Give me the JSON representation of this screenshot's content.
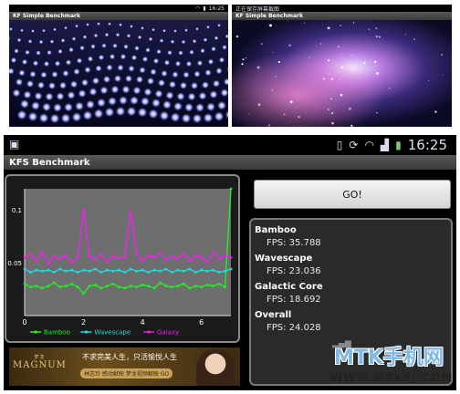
{
  "top_left": {
    "status_time": "16:25",
    "app_title": "KF Simple Benchmark"
  },
  "top_right": {
    "status_text": "正在保存屏幕截图",
    "app_title": "KF Simple Benchmark"
  },
  "main": {
    "status_time": "16:25",
    "app_title": "KFS Benchmark",
    "go_label": "GO!",
    "results": [
      {
        "name": "Bamboo",
        "fps": "FPS: 35.788"
      },
      {
        "name": "Wavescape",
        "fps": "FPS: 23.036"
      },
      {
        "name": "Galactic Core",
        "fps": "FPS: 18.692"
      },
      {
        "name": "Overall",
        "fps": "FPS: 24.028"
      }
    ],
    "ad": {
      "logo": "MAGNUM",
      "logo_sub": "梦龙",
      "line1": "不求完美人生，只活愉悦人生",
      "line2": "林志玲 感动献映 梦龙视频献映 GO"
    }
  },
  "watermark": {
    "title": "MTK手机网",
    "url": "WWW.MTKSJ.COM"
  },
  "colors": {
    "bamboo": "#22ee22",
    "wavescape": "#22dddd",
    "galaxy": "#ee22ee",
    "results_bg": "#2a2a2a"
  },
  "chart_data": {
    "type": "line",
    "xlim": [
      0,
      7
    ],
    "ylim": [
      0,
      0.12
    ],
    "x_ticks": [
      "0",
      "2",
      "4",
      "6"
    ],
    "y_ticks": [
      "0.1",
      "0.05"
    ],
    "series": [
      {
        "name": "Bamboo",
        "x": [
          0.0,
          0.2,
          0.4,
          0.6,
          0.8,
          1.0,
          1.2,
          1.4,
          1.6,
          1.8,
          2.0,
          2.2,
          2.4,
          2.6,
          2.8,
          3.0,
          3.2,
          3.4,
          3.6,
          3.8,
          4.0,
          4.2,
          4.4,
          4.6,
          4.8,
          5.0,
          5.2,
          5.4,
          5.6,
          5.8,
          6.0,
          6.2,
          6.4,
          6.6,
          6.8,
          7.0
        ],
        "values": [
          0.03,
          0.027,
          0.028,
          0.026,
          0.028,
          0.031,
          0.027,
          0.028,
          0.03,
          0.027,
          0.021,
          0.028,
          0.029,
          0.026,
          0.028,
          0.03,
          0.027,
          0.026,
          0.028,
          0.027,
          0.029,
          0.028,
          0.026,
          0.031,
          0.028,
          0.027,
          0.028,
          0.03,
          0.026,
          0.028,
          0.027,
          0.029,
          0.028,
          0.03,
          0.027,
          0.12
        ]
      },
      {
        "name": "Wavescape",
        "x": [
          0.0,
          0.2,
          0.4,
          0.6,
          0.8,
          1.0,
          1.2,
          1.4,
          1.6,
          1.8,
          2.0,
          2.2,
          2.4,
          2.6,
          2.8,
          3.0,
          3.2,
          3.4,
          3.6,
          3.8,
          4.0,
          4.2,
          4.4,
          4.6,
          4.8,
          5.0,
          5.2,
          5.4,
          5.6,
          5.8,
          6.0,
          6.2,
          6.4,
          6.6,
          6.8,
          7.0
        ],
        "values": [
          0.044,
          0.041,
          0.043,
          0.042,
          0.043,
          0.041,
          0.044,
          0.042,
          0.043,
          0.041,
          0.043,
          0.042,
          0.044,
          0.041,
          0.043,
          0.042,
          0.043,
          0.041,
          0.044,
          0.042,
          0.043,
          0.041,
          0.043,
          0.042,
          0.044,
          0.041,
          0.043,
          0.042,
          0.044,
          0.041,
          0.043,
          0.042,
          0.043,
          0.041,
          0.042,
          0.044
        ]
      },
      {
        "name": "Galaxy",
        "x": [
          0.0,
          0.2,
          0.4,
          0.6,
          0.8,
          1.0,
          1.2,
          1.4,
          1.6,
          1.8,
          2.0,
          2.2,
          2.4,
          2.6,
          2.8,
          3.0,
          3.2,
          3.4,
          3.6,
          3.8,
          4.0,
          4.2,
          4.4,
          4.6,
          4.8,
          5.0,
          5.2,
          5.4,
          5.6,
          5.8,
          6.0,
          6.2,
          6.4,
          6.6,
          6.8,
          7.0
        ],
        "values": [
          0.055,
          0.058,
          0.052,
          0.06,
          0.049,
          0.056,
          0.054,
          0.057,
          0.05,
          0.055,
          0.1,
          0.056,
          0.053,
          0.058,
          0.051,
          0.057,
          0.054,
          0.056,
          0.099,
          0.058,
          0.052,
          0.057,
          0.055,
          0.059,
          0.053,
          0.056,
          0.054,
          0.058,
          0.052,
          0.057,
          0.055,
          0.05,
          0.06,
          0.054,
          0.057,
          0.055
        ]
      }
    ]
  }
}
